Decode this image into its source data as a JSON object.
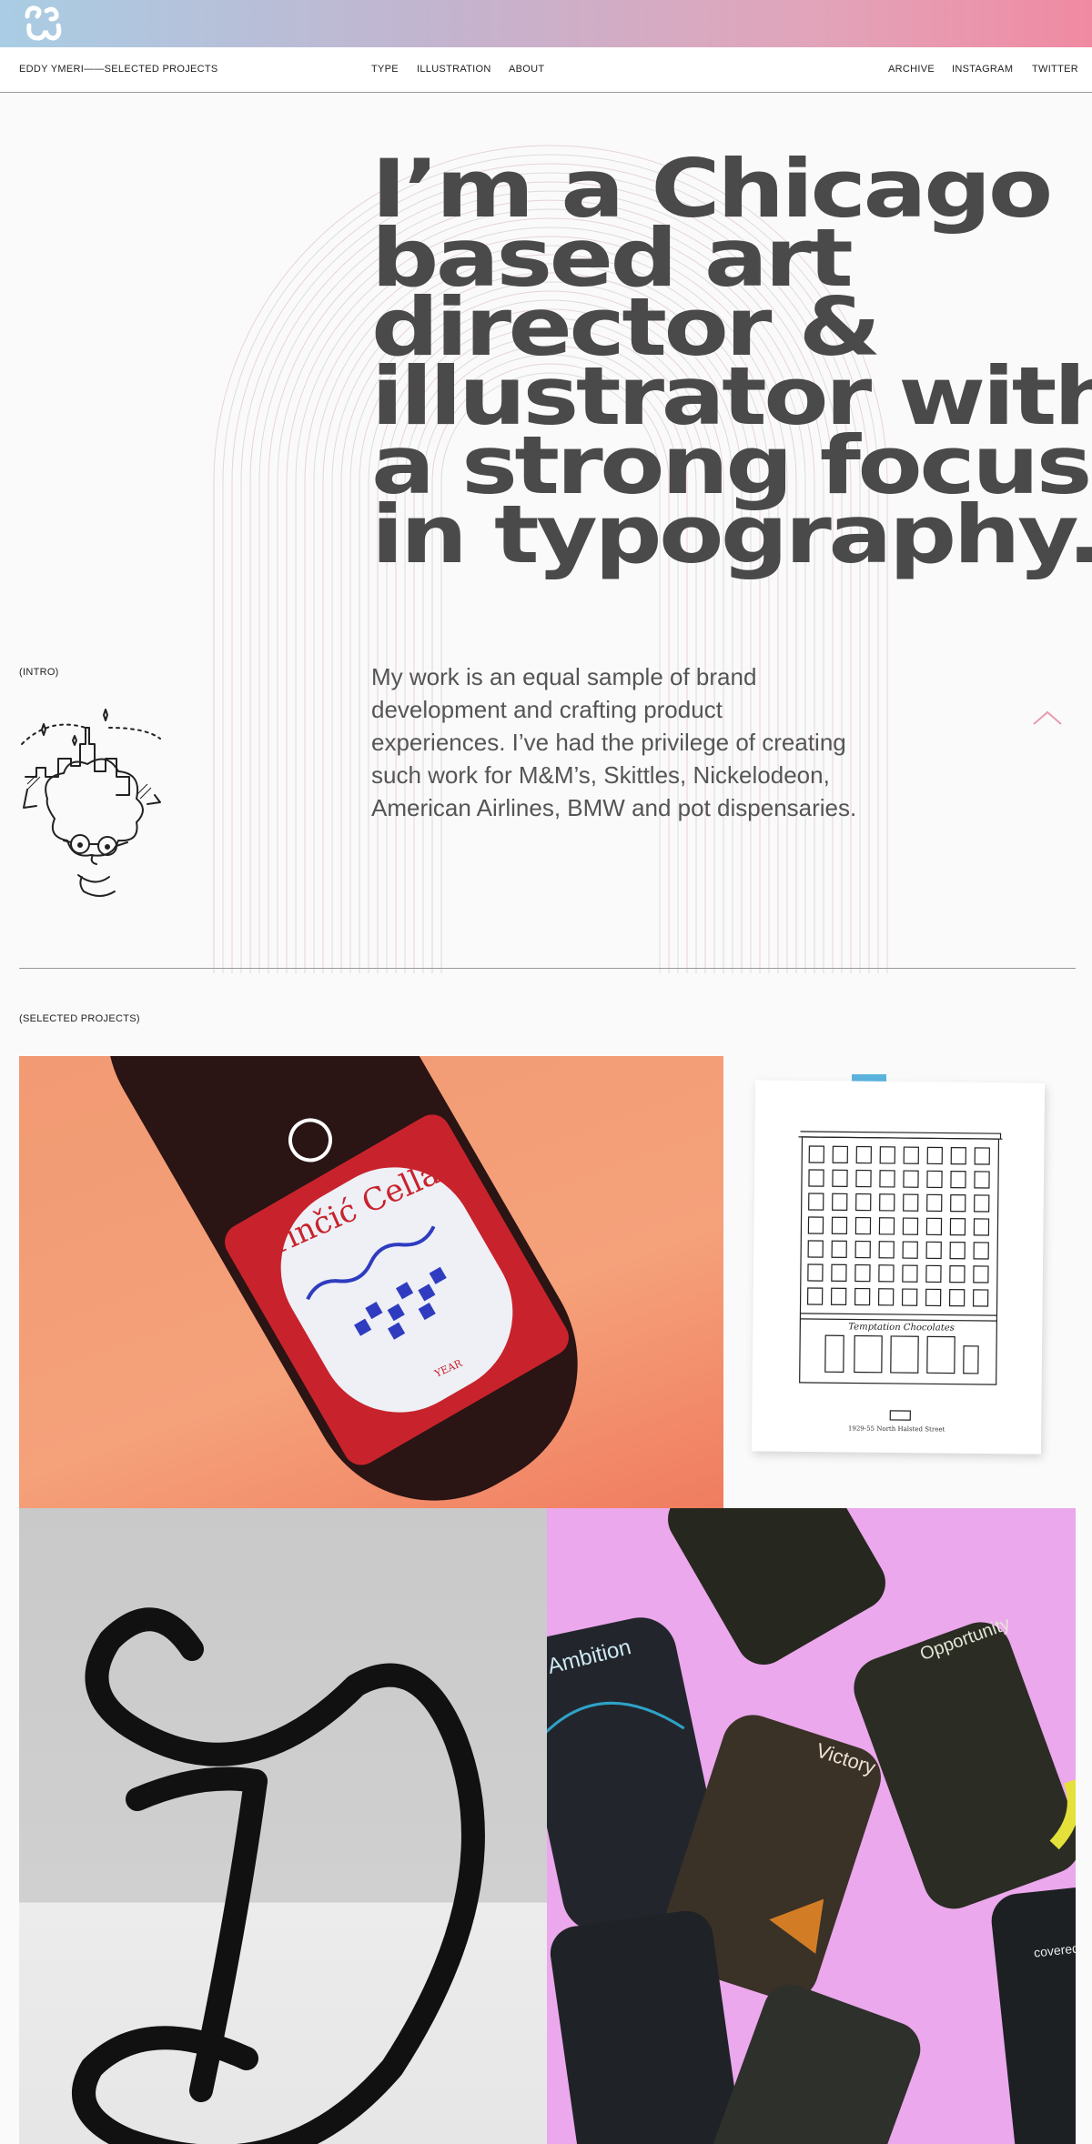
{
  "header": {
    "logo_icon": "ew-monogram-logo",
    "brand": "EDDY YMERI——SELECTED PROJECTS"
  },
  "nav": {
    "center": [
      "TYPE",
      "ILLUSTRATION",
      "ABOUT"
    ],
    "right": [
      "ARCHIVE",
      "INSTAGRAM",
      "TWITTER"
    ]
  },
  "hero": {
    "headline_lines": [
      "I’m a Chicago",
      "based art",
      "director &",
      "illustrator with",
      "a strong focus",
      "in typography."
    ]
  },
  "intro": {
    "label": "(INTRO)",
    "text_lines": [
      "My work is an equal sample of brand",
      "development and crafting product",
      "experiences. I’ve had the privilege of creating",
      "such work for M&M’s, Skittles, Nickelodeon,",
      "American Airlines, BMW and pot dispensaries."
    ],
    "scroll_icon": "chevron-up-icon"
  },
  "projects": {
    "label": "(SELECTED PROJECTS)",
    "wine_label": {
      "brand": "Kirinčić Cellars",
      "year": "YEAR"
    },
    "building_caption": "1929-55 North Halsted Street",
    "sign_text": "Temptation Chocolates",
    "packs": [
      "Ambition",
      "Opportunity",
      "Victory",
      "covered"
    ]
  },
  "colors": {
    "gradient_start": "#a9cde4",
    "gradient_end": "#f08aa2",
    "headline": "#4a4a4a",
    "accent_pink": "#e89bb0"
  }
}
